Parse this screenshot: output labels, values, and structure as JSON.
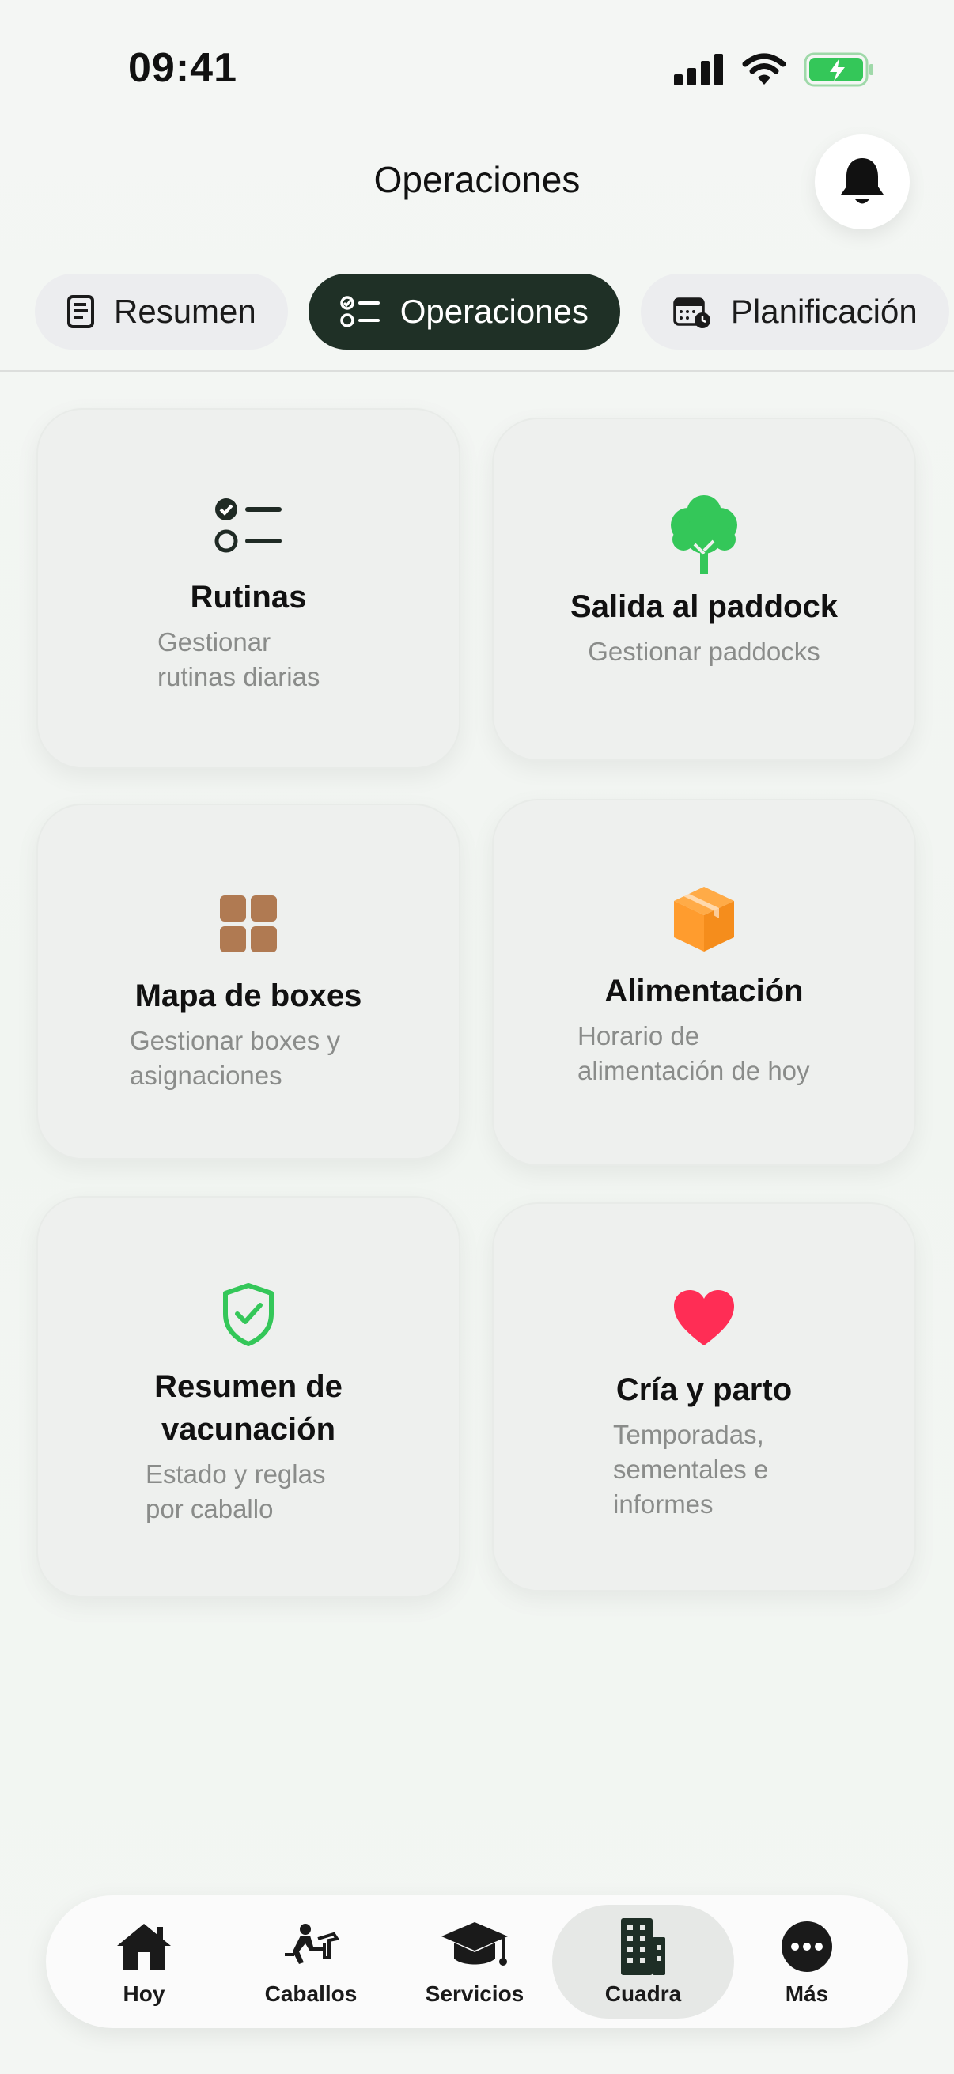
{
  "status_bar": {
    "time": "09:41"
  },
  "header": {
    "title": "Operaciones"
  },
  "tabs": [
    {
      "label": "Resumen",
      "icon": "document-icon",
      "active": false
    },
    {
      "label": "Operaciones",
      "icon": "checklist-icon",
      "active": true
    },
    {
      "label": "Planificación",
      "icon": "calendar-clock-icon",
      "active": false
    }
  ],
  "cards": [
    {
      "title": "Rutinas",
      "subtitle": "Gestionar rutinas diarias",
      "icon": "checklist-icon"
    },
    {
      "title": "Salida al paddock",
      "subtitle": "Gestionar paddocks",
      "icon": "tree-icon",
      "icon_color": "#34c759"
    },
    {
      "title": "Mapa de boxes",
      "subtitle": "Gestionar boxes y asignaciones",
      "icon": "grid-icon",
      "icon_color": "#b07a52"
    },
    {
      "title": "Alimentación",
      "subtitle": "Horario de alimentación de hoy",
      "icon": "box-icon",
      "icon_color": "#ff9c2e"
    },
    {
      "title": "Resumen de vacunación",
      "subtitle": "Estado y reglas por caballo",
      "icon": "shield-check-icon",
      "icon_color": "#34c759"
    },
    {
      "title": "Cría y parto",
      "subtitle": "Temporadas, sementales e informes",
      "icon": "heart-icon",
      "icon_color": "#ff2d55"
    }
  ],
  "bottom_nav": [
    {
      "label": "Hoy",
      "icon": "home-icon",
      "active": false
    },
    {
      "label": "Caballos",
      "icon": "rider-icon",
      "active": false
    },
    {
      "label": "Servicios",
      "icon": "graduation-cap-icon",
      "active": false
    },
    {
      "label": "Cuadra",
      "icon": "building-icon",
      "active": true
    },
    {
      "label": "Más",
      "icon": "more-icon",
      "active": false
    }
  ],
  "colors": {
    "accent_dark": "#1f3026",
    "battery_green": "#34c759"
  }
}
